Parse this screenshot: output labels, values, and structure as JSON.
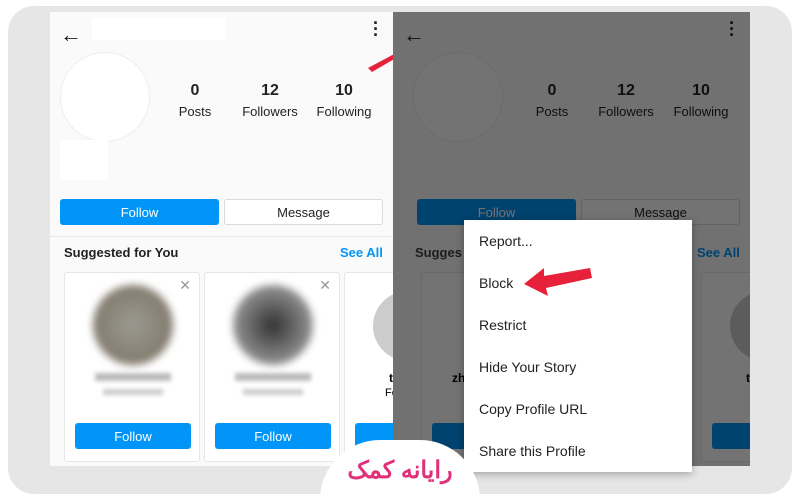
{
  "profile": {
    "posts_count": "0",
    "posts_label": "Posts",
    "followers_count": "12",
    "followers_label": "Followers",
    "following_count": "10",
    "following_label": "Following",
    "follow_label": "Follow",
    "message_label": "Message"
  },
  "suggested": {
    "title": "Suggested for You",
    "see_all": "See All",
    "cards": [
      {
        "follow": "Follow"
      },
      {
        "follow": "Follow"
      },
      {
        "name_partial": "t",
        "sub_partial": "Fo"
      }
    ]
  },
  "right_partial": {
    "sugg": "Sugges",
    "card1_name": "zh",
    "card1_sub": "zh"
  },
  "menu": {
    "items": [
      "Report...",
      "Block",
      "Restrict",
      "Hide Your Story",
      "Copy Profile URL",
      "Share this Profile"
    ]
  },
  "colors": {
    "accent": "#0095f6",
    "arrow": "#e8213b",
    "logo": "#e0307a"
  },
  "logo": {
    "text": "رایانه کمک"
  }
}
